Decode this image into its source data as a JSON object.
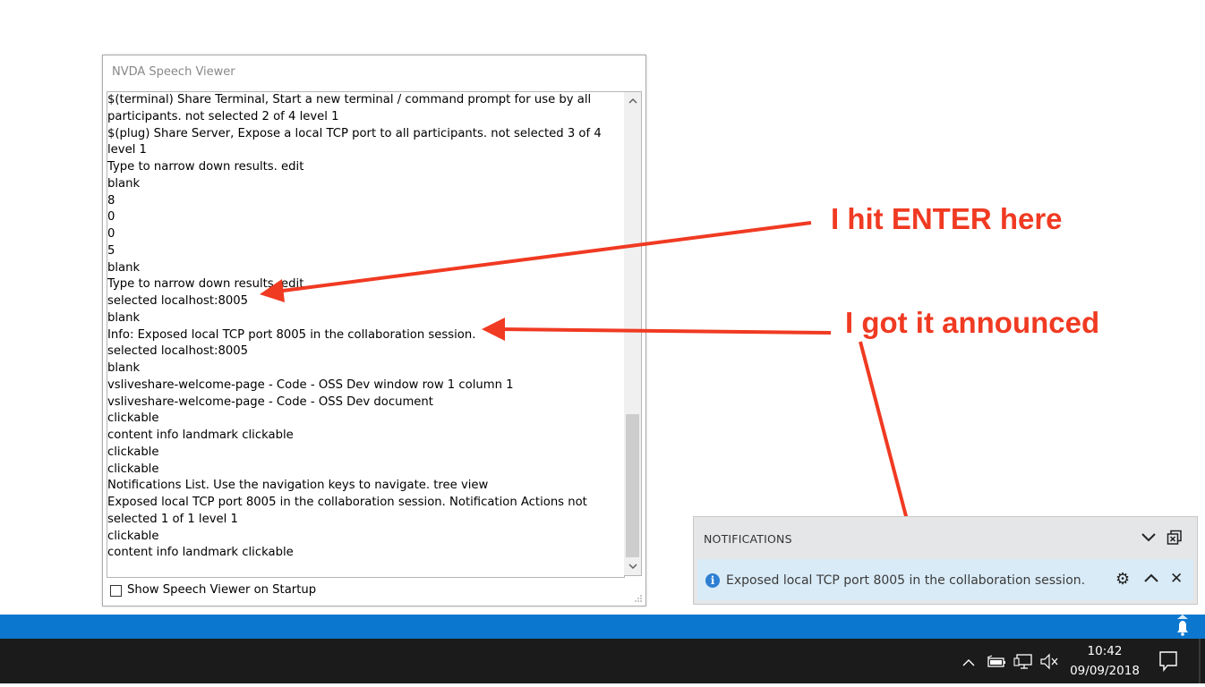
{
  "window": {
    "title": "NVDA Speech Viewer",
    "log_lines": [
      "$(terminal) Share Terminal, Start a new terminal / command prompt for use by all",
      "participants.  not selected  2 of 4  level 1",
      "$(plug) Share Server, Expose a local TCP port to all participants.  not selected  3 of 4",
      "level 1",
      "Type to narrow down results.  edit",
      "blank",
      "8",
      "0",
      "0",
      "5",
      "blank",
      "Type to narrow down results.  edit",
      "selected localhost:8005",
      "blank",
      "Info: Exposed local TCP port 8005 in the collaboration session.",
      "selected localhost:8005",
      "blank",
      "vsliveshare-welcome-page - Code - OSS Dev  window  row 1  column 1",
      "vsliveshare-welcome-page - Code - OSS Dev  document",
      "clickable",
      "content info landmark clickable",
      "clickable",
      "clickable",
      "Notifications List. Use the navigation keys to navigate.  tree view",
      "Exposed local TCP port 8005 in the collaboration session. Notification Actions  not",
      "selected  1 of 1  level 1",
      "clickable",
      "content info landmark clickable"
    ],
    "startup_checkbox_label": "Show Speech Viewer on Startup",
    "startup_checkbox_checked": false
  },
  "annotations": {
    "first": "I hit ENTER here",
    "second": "I got it announced",
    "color": "#f03a22"
  },
  "notifications": {
    "header": "NOTIFICATIONS",
    "message": "Exposed local TCP port 8005 in the collaboration session.",
    "icons": [
      "chevron-down-icon",
      "clear-all-icon",
      "info-icon",
      "gear-icon",
      "chevron-up-icon",
      "close-icon"
    ]
  },
  "taskbar": {
    "time": "10:42",
    "date": "09/09/2018",
    "tray_icons": [
      "chevron-up-icon",
      "battery-icon",
      "network-icon",
      "volume-muted-icon",
      "action-center-icon"
    ],
    "accent_color": "#0b77cf"
  }
}
